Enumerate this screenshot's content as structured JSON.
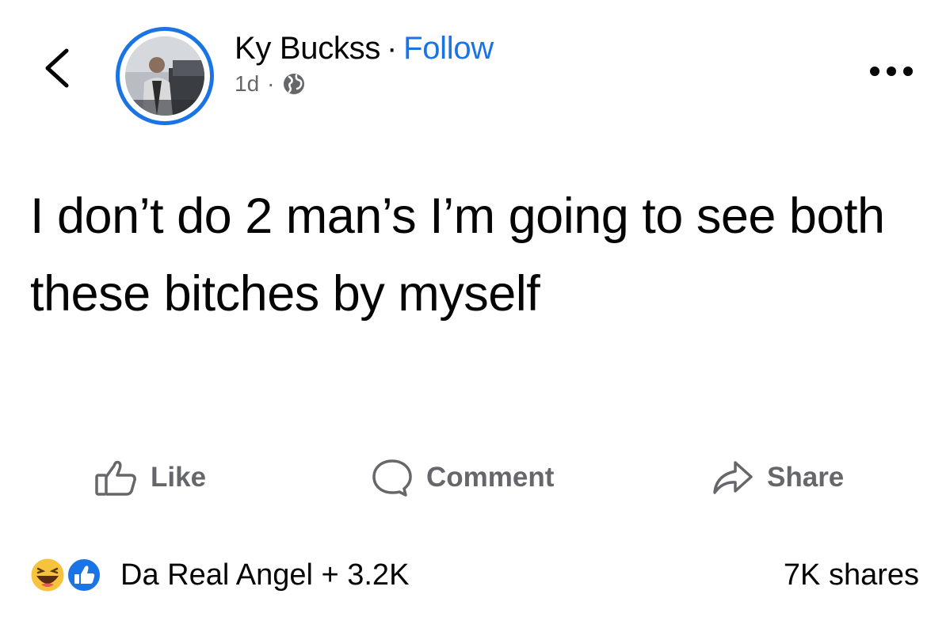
{
  "post": {
    "author_name": "Ky Buckss",
    "separator": "·",
    "follow_label": "Follow",
    "time": "1d",
    "meta_separator": "·",
    "privacy_icon": "globe-icon",
    "text": "I don’t do 2 man’s I’m going to see both these bitches by myself"
  },
  "actions": {
    "like_label": "Like",
    "comment_label": "Comment",
    "share_label": "Share"
  },
  "reactions": {
    "icons": [
      "haha-icon",
      "like-reaction-icon"
    ],
    "summary": "Da Real Angel + 3.2K",
    "shares": "7K shares"
  },
  "colors": {
    "accent": "#1b74e4",
    "text": "#050505",
    "muted": "#65676b"
  }
}
